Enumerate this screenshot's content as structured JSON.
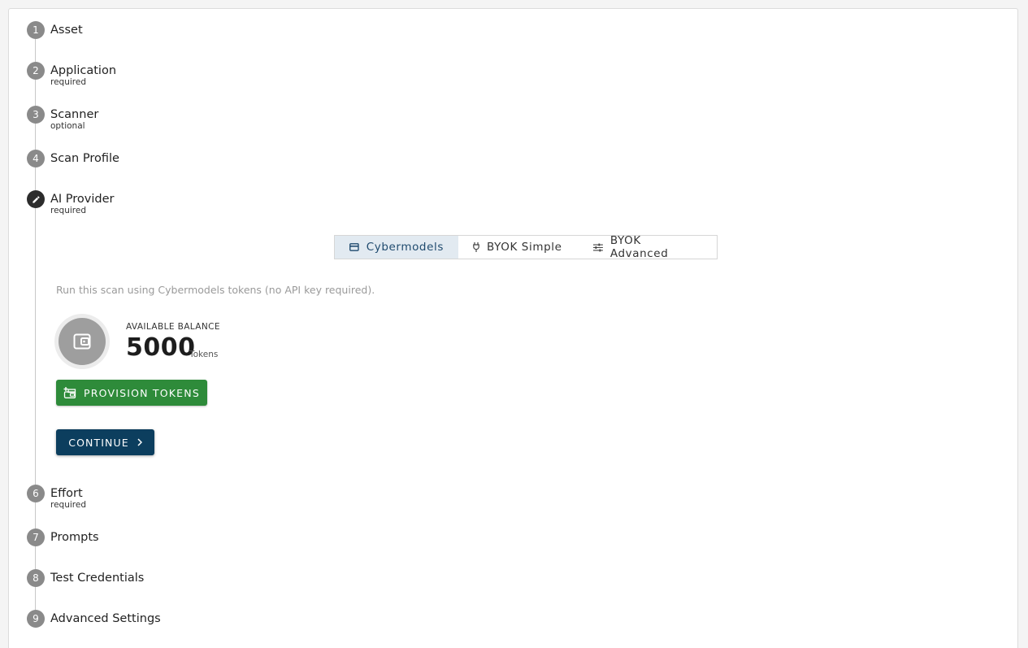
{
  "steps": [
    {
      "number": "1",
      "title": "Asset",
      "subtitle": ""
    },
    {
      "number": "2",
      "title": "Application",
      "subtitle": "required"
    },
    {
      "number": "3",
      "title": "Scanner",
      "subtitle": "optional"
    },
    {
      "number": "4",
      "title": "Scan Profile",
      "subtitle": ""
    },
    {
      "number": "",
      "title": "AI Provider",
      "subtitle": "required",
      "icon": "pencil-icon"
    },
    {
      "number": "6",
      "title": "Effort",
      "subtitle": "required"
    },
    {
      "number": "7",
      "title": "Prompts",
      "subtitle": ""
    },
    {
      "number": "8",
      "title": "Test Credentials",
      "subtitle": ""
    },
    {
      "number": "9",
      "title": "Advanced Settings",
      "subtitle": ""
    }
  ],
  "provider_tabs": [
    {
      "label": "Cybermodels",
      "icon": "credit-card-icon",
      "selected": true
    },
    {
      "label": "BYOK Simple",
      "icon": "plug-icon",
      "selected": false
    },
    {
      "label": "BYOK Advanced",
      "icon": "sliders-icon",
      "selected": false
    }
  ],
  "cybermodels": {
    "description": "Run this scan using Cybermodels tokens (no API key required).",
    "balance_label": "AVAILABLE BALANCE",
    "balance_value": "5000",
    "balance_unit": "Tokens",
    "wallet_icon": "wallet-icon"
  },
  "buttons": {
    "provision_label": "PROVISION TOKENS",
    "continue_label": "CONTINUE"
  },
  "colors": {
    "step_badge": "#8a8a8a",
    "active_badge": "#2c2c2c",
    "selected_tab_bg": "#e2eaf1",
    "provision_button": "#2e8b3a",
    "continue_button": "#0c3e5e"
  }
}
